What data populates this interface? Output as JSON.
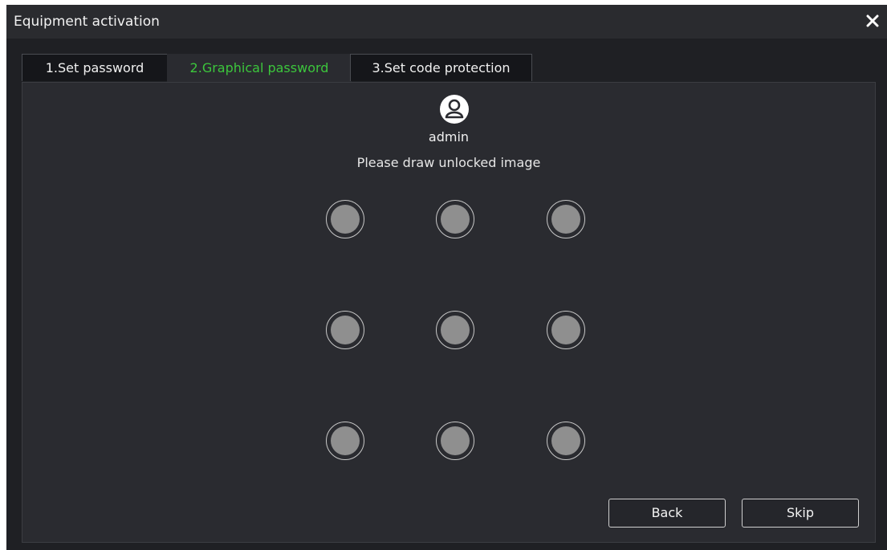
{
  "window": {
    "title": "Equipment activation",
    "close_icon": "close-icon"
  },
  "tabs": [
    {
      "label": "1.Set password",
      "active": false
    },
    {
      "label": "2.Graphical password",
      "active": true
    },
    {
      "label": "3.Set code protection",
      "active": false
    }
  ],
  "user": {
    "avatar_icon": "user-avatar-icon",
    "name": "admin"
  },
  "pattern": {
    "prompt": "Please draw unlocked image",
    "grid": "3x3"
  },
  "buttons": {
    "back_label": "Back",
    "skip_label": "Skip"
  },
  "colors": {
    "active_tab_text": "#3cc63c",
    "background": "#1f2024",
    "panel": "#2a2b30",
    "dot_fill": "#8f8f8f"
  }
}
